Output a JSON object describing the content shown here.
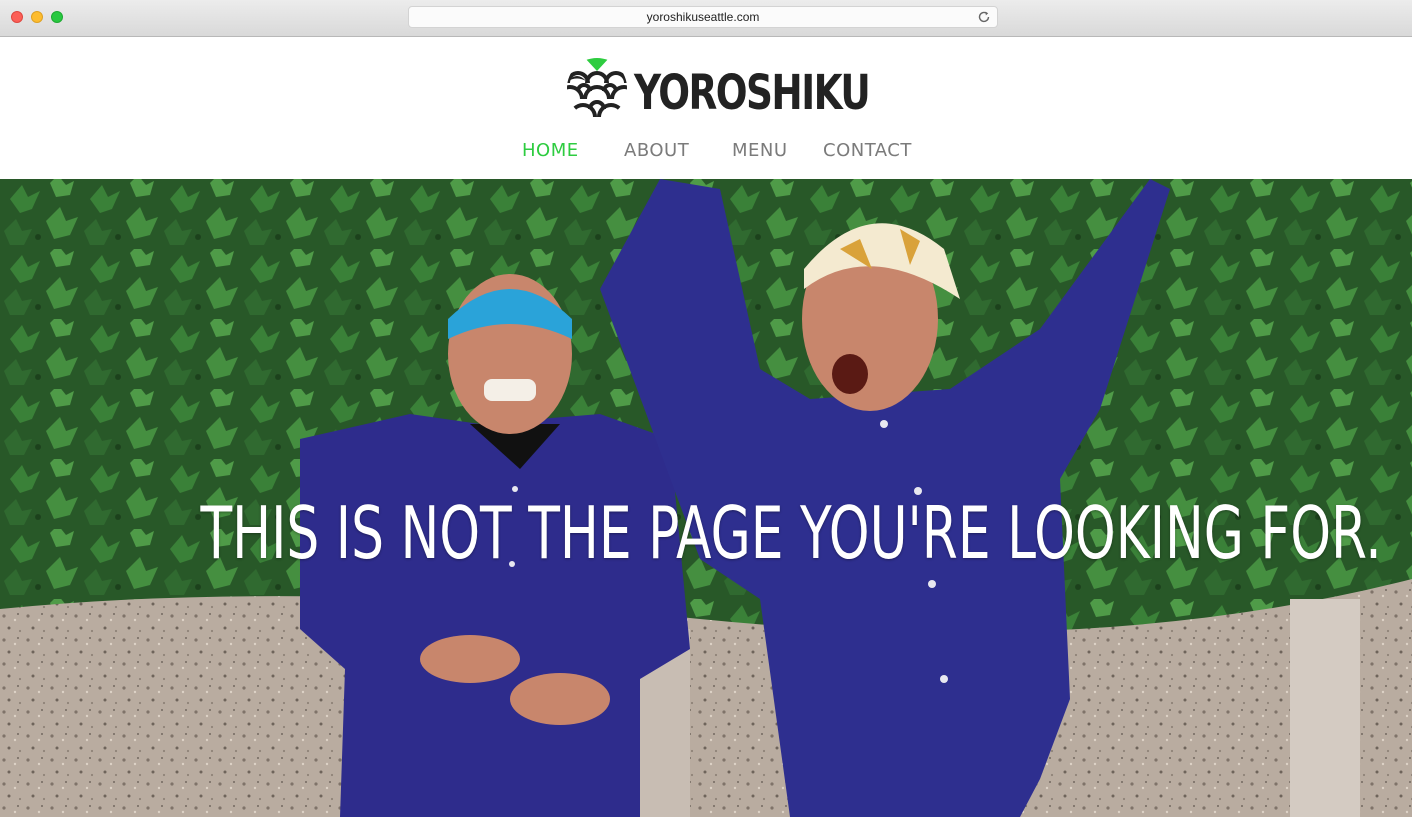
{
  "browser": {
    "url": "yoroshikuseattle.com",
    "icons": {
      "reload": "reload-icon"
    }
  },
  "site": {
    "logo_text": "YOROSHIKU",
    "brand_color": "#2ecc40"
  },
  "nav": {
    "items": [
      {
        "label": "HOME",
        "active": true
      },
      {
        "label": "ABOUT",
        "active": false
      },
      {
        "label": "MENU",
        "active": false
      },
      {
        "label": "CONTACT",
        "active": false
      }
    ]
  },
  "hero": {
    "headline": "THIS IS NOT THE PAGE YOU'RE LOOKING FOR."
  }
}
